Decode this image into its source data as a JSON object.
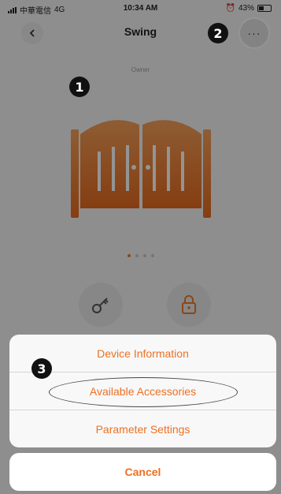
{
  "status_bar": {
    "carrier": "中華電信",
    "network": "4G",
    "time": "10:34 AM",
    "battery": "43%"
  },
  "nav": {
    "back_icon": "chevron-left-icon",
    "title": "Swing",
    "more_label": "···"
  },
  "device": {
    "role": "Owner",
    "page_count": 4,
    "active_page": 1
  },
  "callouts": [
    "1",
    "2",
    "3"
  ],
  "action_sheet": {
    "items": [
      "Device Information",
      "Available Accessories",
      "Parameter Settings"
    ],
    "cancel": "Cancel"
  },
  "colors": {
    "accent": "#ee7022",
    "gate_top": "#f5a05a",
    "gate_bottom": "#e66a1f"
  }
}
